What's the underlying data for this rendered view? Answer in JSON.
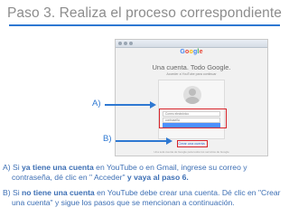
{
  "slide": {
    "title": "Paso 3. Realiza el proceso correspondiente"
  },
  "screenshot": {
    "logo_letters": [
      "G",
      "o",
      "o",
      "g",
      "l",
      "e"
    ],
    "heading": "Una cuenta. Todo Google.",
    "subheading": "Acceder a YouTube para continuar",
    "email_placeholder": "Correo electrónico",
    "password_placeholder": "contraseña",
    "create_account_link": "Crear una cuenta",
    "footer": "Una sola cuenta de Google para todos los servicios de Google"
  },
  "callouts": {
    "a_label": "A)",
    "b_label": "B)"
  },
  "notes": {
    "a": {
      "prefix": "A)  Si ",
      "bold1": "ya tiene una cuenta",
      "mid": "  en YouTube o en Gmail, ingrese su correo y contraseña, dé clic en \" Acceder\" ",
      "bold2": "y vaya al paso 6."
    },
    "b": {
      "prefix": "B)  Si ",
      "bold1": "no tiene una cuenta",
      "rest": " en YouTube debe crear una cuenta. Dé clic en \"Crear una cuenta\" y sigue los pasos que se mencionan a continuación."
    }
  },
  "colors": {
    "accent_blue": "#2e78d2",
    "highlight_red": "#d8232a",
    "title_gray": "#8c8c8c"
  }
}
